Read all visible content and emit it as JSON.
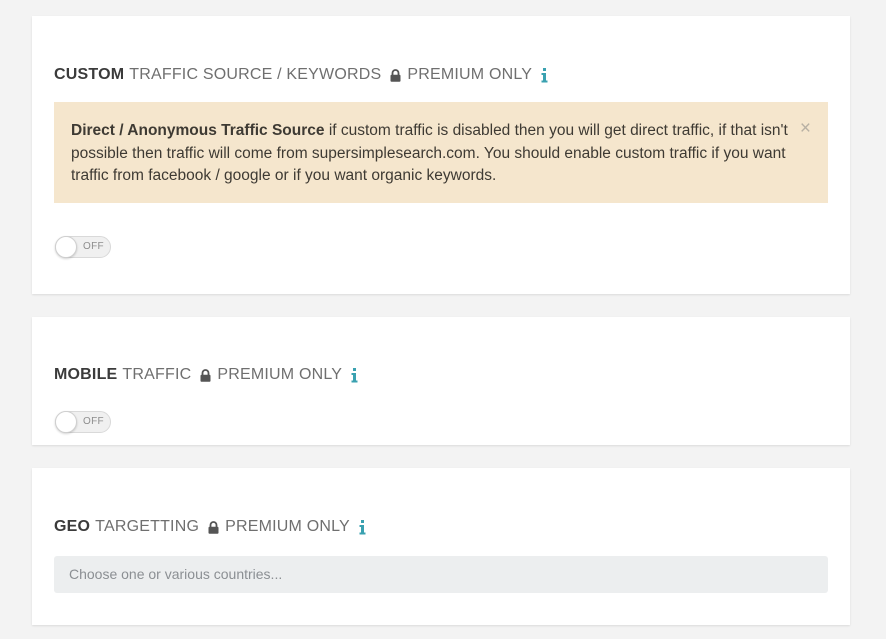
{
  "sections": {
    "custom": {
      "title_bold": "CUSTOM",
      "title_rest": "TRAFFIC SOURCE / KEYWORDS",
      "premium_label": "PREMIUM ONLY",
      "alert": {
        "bold": "Direct / Anonymous Traffic Source",
        "text": " if custom traffic is disabled then you will get direct traffic, if that isn't possible then traffic will come from supersimplesearch.com. You should enable custom traffic if you want traffic from facebook / google or if you want organic keywords.",
        "close_glyph": "×"
      },
      "toggle": {
        "label": "OFF",
        "enabled": false
      }
    },
    "mobile": {
      "title_bold": "MOBILE",
      "title_rest": "TRAFFIC",
      "premium_label": "PREMIUM ONLY",
      "toggle": {
        "label": "OFF",
        "enabled": false
      }
    },
    "geo": {
      "title_bold": "GEO",
      "title_rest": "TARGETTING",
      "premium_label": "PREMIUM ONLY",
      "select_placeholder": "Choose one or various countries..."
    }
  },
  "icons": {
    "lock": "lock-icon",
    "info": "info-icon",
    "close": "close-icon"
  },
  "colors": {
    "info_accent": "#3aa1b0",
    "alert_background": "#f5e6cd",
    "page_background": "#f3f3f3"
  }
}
